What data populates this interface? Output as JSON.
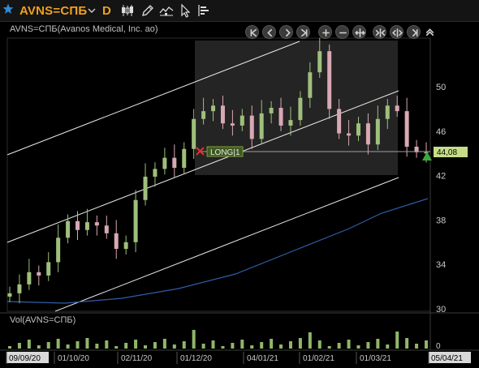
{
  "toolbar": {
    "symbol": "AVNS=СПБ",
    "period": "D",
    "icons": [
      "star-icon",
      "chevron-down-icon",
      "candlestick-icon",
      "pencil-icon",
      "indicators-icon",
      "cursor-icon",
      "order-book-icon"
    ]
  },
  "chart": {
    "title": "AVNS=СПБ(Avanos Medical, Inc. ao)",
    "volume_title": "Vol(AVNS=СПБ)",
    "position_label": "LONG|1",
    "last_price_label": "44,08",
    "nav_icons": [
      "scroll-start-icon",
      "scroll-left-icon",
      "scroll-right-icon",
      "scroll-end-icon",
      "zoom-in-icon",
      "zoom-out-icon",
      "fit-icon",
      "expand-icon",
      "compress-icon",
      "toggle-icon",
      "collapse-up-icon"
    ],
    "colors": {
      "up": "#9fbf7c",
      "down": "#d8a8b4",
      "volume": "#8fb66a",
      "ma": "#2f5ea8",
      "accent": "#f0a020"
    }
  },
  "chart_data": {
    "type": "candlestick",
    "y_ticks": [
      "50",
      "46",
      "42",
      "38",
      "34",
      "30"
    ],
    "volume_ticks": [
      "0"
    ],
    "x_ticks": [
      "09/09/20",
      "01/10/20",
      "02/11/20",
      "01/12/20",
      "04/01/21",
      "01/02/21",
      "01/03/21",
      "05/04/21"
    ],
    "ylim": [
      29.5,
      54
    ],
    "last_price": 44.08,
    "position": {
      "side": "LONG",
      "qty": 1,
      "entry_price": 44.3
    },
    "close_series": [
      {
        "date": "09/09/20",
        "close": 31.4
      },
      {
        "date": "14/09/20",
        "close": 32.2
      },
      {
        "date": "18/09/20",
        "close": 33.3
      },
      {
        "date": "23/09/20",
        "close": 33.0
      },
      {
        "date": "28/09/20",
        "close": 34.2
      },
      {
        "date": "01/10/20",
        "close": 36.4
      },
      {
        "date": "06/10/20",
        "close": 37.9
      },
      {
        "date": "12/10/20",
        "close": 37.1
      },
      {
        "date": "16/10/20",
        "close": 37.8
      },
      {
        "date": "21/10/20",
        "close": 37.5
      },
      {
        "date": "26/10/20",
        "close": 36.8
      },
      {
        "date": "30/10/20",
        "close": 35.4
      },
      {
        "date": "02/11/20",
        "close": 36.0
      },
      {
        "date": "06/11/20",
        "close": 39.8
      },
      {
        "date": "11/11/20",
        "close": 41.9
      },
      {
        "date": "17/11/20",
        "close": 42.6
      },
      {
        "date": "23/11/20",
        "close": 43.6
      },
      {
        "date": "27/11/20",
        "close": 42.7
      },
      {
        "date": "01/12/20",
        "close": 44.4
      },
      {
        "date": "07/12/20",
        "close": 47.1
      },
      {
        "date": "11/12/20",
        "close": 47.8
      },
      {
        "date": "16/12/20",
        "close": 48.3
      },
      {
        "date": "22/12/20",
        "close": 46.7
      },
      {
        "date": "28/12/20",
        "close": 46.5
      },
      {
        "date": "04/01/21",
        "close": 47.4
      },
      {
        "date": "08/01/21",
        "close": 45.3
      },
      {
        "date": "14/01/21",
        "close": 47.6
      },
      {
        "date": "20/01/21",
        "close": 48.1
      },
      {
        "date": "26/01/21",
        "close": 46.5
      },
      {
        "date": "01/02/21",
        "close": 47.0
      },
      {
        "date": "05/02/21",
        "close": 49.0
      },
      {
        "date": "09/02/21",
        "close": 51.3
      },
      {
        "date": "12/02/21",
        "close": 53.2
      },
      {
        "date": "17/02/21",
        "close": 48.0
      },
      {
        "date": "22/02/21",
        "close": 45.8
      },
      {
        "date": "26/02/21",
        "close": 45.6
      },
      {
        "date": "01/03/21",
        "close": 46.7
      },
      {
        "date": "05/03/21",
        "close": 44.8
      },
      {
        "date": "10/03/21",
        "close": 47.1
      },
      {
        "date": "16/03/21",
        "close": 48.3
      },
      {
        "date": "22/03/21",
        "close": 47.8
      },
      {
        "date": "26/03/21",
        "close": 44.6
      },
      {
        "date": "31/03/21",
        "close": 44.1
      },
      {
        "date": "05/04/21",
        "close": 44.08
      }
    ],
    "moving_average": [
      {
        "date": "09/09/20",
        "value": 30.4
      },
      {
        "date": "01/10/20",
        "value": 30.3
      },
      {
        "date": "02/11/20",
        "value": 31.4
      },
      {
        "date": "01/12/20",
        "value": 32.6
      },
      {
        "date": "04/01/21",
        "value": 34.0
      },
      {
        "date": "01/02/21",
        "value": 36.0
      },
      {
        "date": "01/03/21",
        "value": 38.2
      },
      {
        "date": "05/04/21",
        "value": 39.8
      }
    ],
    "grid": false,
    "legend": "none"
  }
}
